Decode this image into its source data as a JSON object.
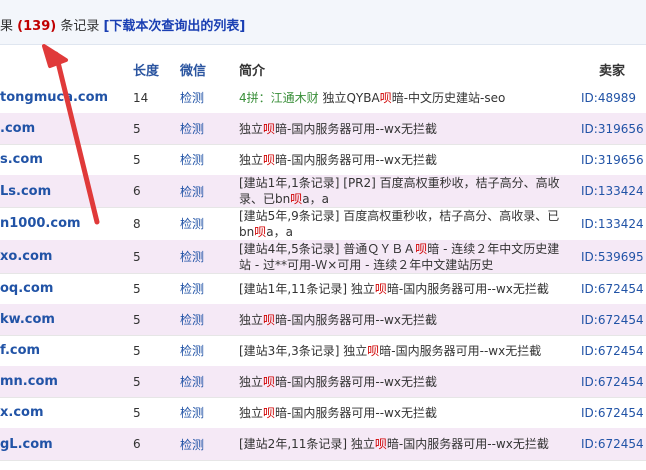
{
  "header": {
    "prefix": "果",
    "count": "(139)",
    "records_text": "条记录",
    "download_link": "[下载本次查询出的列表]"
  },
  "columns": {
    "length": "长度",
    "wechat": "微信",
    "intro": "简介",
    "seller": "卖家"
  },
  "rows": [
    {
      "domain": "tongmuca.com",
      "len": "14",
      "check": "检测",
      "intro_pre": "4拼：江通木财",
      "intro_mid": " 独立QYBA",
      "red": "呗",
      "intro_post": "暗-中文历史建站-seo",
      "green": true,
      "seller": "ID:48989"
    },
    {
      "domain": ".com",
      "len": "5",
      "check": "检测",
      "intro_pre": "",
      "intro_mid": "独立",
      "red": "呗",
      "intro_post": "暗-国内服务器可用--wx无拦截",
      "green": false,
      "seller": "ID:319656"
    },
    {
      "domain": "s.com",
      "len": "5",
      "check": "检测",
      "intro_pre": "",
      "intro_mid": "独立",
      "red": "呗",
      "intro_post": "暗-国内服务器可用--wx无拦截",
      "green": false,
      "seller": "ID:319656"
    },
    {
      "domain": "Ls.com",
      "len": "6",
      "check": "检测",
      "intro_pre": "",
      "intro_mid": "[建站1年,1条记录] [PR2] 百度高权重秒收，桔子高分、高收录、已bn",
      "red": "呗",
      "intro_post": "a，a",
      "green": false,
      "seller": "ID:133424"
    },
    {
      "domain": "n1000.com",
      "len": "8",
      "check": "检测",
      "intro_pre": "",
      "intro_mid": "[建站5年,9条记录] 百度高权重秒收，桔子高分、高收录、已bn",
      "red": "呗",
      "intro_post": "a，a",
      "green": false,
      "seller": "ID:133424"
    },
    {
      "domain": "xo.com",
      "len": "5",
      "check": "检测",
      "intro_pre": "",
      "intro_mid": "[建站4年,5条记录] 普通ＱＹＢＡ",
      "red": "呗",
      "intro_post": "暗 - 连续２年中文历史建站 - 过**可用-Ｗ×可用 - 连续２年中文建站历史",
      "green": false,
      "seller": "ID:539695"
    },
    {
      "domain": "oq.com",
      "len": "5",
      "check": "检测",
      "intro_pre": "",
      "intro_mid": "[建站1年,11条记录] 独立",
      "red": "呗",
      "intro_post": "暗-国内服务器可用--wx无拦截",
      "green": false,
      "seller": "ID:672454"
    },
    {
      "domain": "kw.com",
      "len": "5",
      "check": "检测",
      "intro_pre": "",
      "intro_mid": "独立",
      "red": "呗",
      "intro_post": "暗-国内服务器可用--wx无拦截",
      "green": false,
      "seller": "ID:672454"
    },
    {
      "domain": "f.com",
      "len": "5",
      "check": "检测",
      "intro_pre": "",
      "intro_mid": "[建站3年,3条记录] 独立",
      "red": "呗",
      "intro_post": "暗-国内服务器可用--wx无拦截",
      "green": false,
      "seller": "ID:672454"
    },
    {
      "domain": "mn.com",
      "len": "5",
      "check": "检测",
      "intro_pre": "",
      "intro_mid": "独立",
      "red": "呗",
      "intro_post": "暗-国内服务器可用--wx无拦截",
      "green": false,
      "seller": "ID:672454"
    },
    {
      "domain": "x.com",
      "len": "5",
      "check": "检测",
      "intro_pre": "",
      "intro_mid": "独立",
      "red": "呗",
      "intro_post": "暗-国内服务器可用--wx无拦截",
      "green": false,
      "seller": "ID:672454"
    },
    {
      "domain": "gL.com",
      "len": "6",
      "check": "检测",
      "intro_pre": "",
      "intro_mid": "[建站2年,11条记录] 独立",
      "red": "呗",
      "intro_post": "暗-国内服务器可用--wx无拦截",
      "green": false,
      "seller": "ID:672454"
    }
  ],
  "colors": {
    "accent_link": "#2153a6",
    "count_red": "#c00000",
    "row_alt": "#f5e9f6",
    "arrow": "#e03a3a"
  }
}
